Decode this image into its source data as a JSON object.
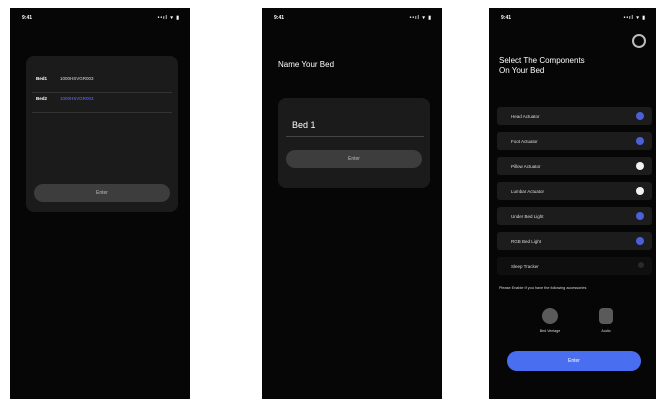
{
  "screens": [
    {
      "status": {
        "time": "9:41",
        "signal": "••ıl ▾ ▮"
      },
      "fields": [
        {
          "label": "Bed1",
          "value": "1000HSVGR003"
        },
        {
          "label": "Bed2",
          "value": "1000HSVGR003"
        }
      ],
      "enter_label": "Enter"
    },
    {
      "status": {
        "time": "9:41",
        "signal": "••ıl ▾ ▮"
      },
      "title": "Name Your Bed",
      "bed_name": "Bed 1",
      "enter_label": "Enter"
    },
    {
      "status": {
        "time": "9:41",
        "signal": "••ıl ▾ ▮"
      },
      "title_line1": "Select The Components",
      "title_line2": "On Your Bed",
      "components": [
        {
          "label": "Head Actuator",
          "state": "on",
          "color": "#4a5fd8"
        },
        {
          "label": "Foot Actuator",
          "state": "on",
          "color": "#4a5fd8"
        },
        {
          "label": "Pillow Actuator",
          "state": "off",
          "color": "#f2f2f2"
        },
        {
          "label": "Lumbar Actuator",
          "state": "off",
          "color": "#f2f2f2"
        },
        {
          "label": "Under Bed Light",
          "state": "on",
          "color": "#4a5fd8"
        },
        {
          "label": "RGB Bed Light",
          "state": "on",
          "color": "#4a5fd8"
        },
        {
          "label": "Sleep Tracker",
          "state": "none",
          "color": "#2a2a2a"
        }
      ],
      "hint": "Please Enable If you have the following accessories",
      "accessories": [
        {
          "label": "Bed Ventage",
          "icon": "fan-icon"
        },
        {
          "label": "Audio",
          "icon": "speaker-icon"
        }
      ],
      "enter_label": "Enter",
      "accent": "#4a6ef0"
    }
  ]
}
